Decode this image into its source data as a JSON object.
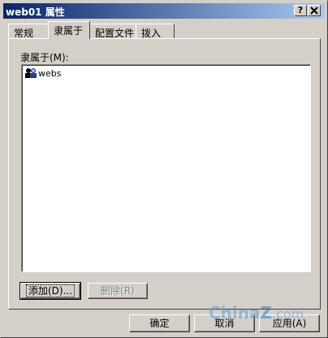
{
  "window": {
    "title": "web01 属性",
    "help_btn": "?",
    "close_btn": "X"
  },
  "tabs": [
    {
      "label": "常规"
    },
    {
      "label": "隶属于"
    },
    {
      "label": "配置文件"
    },
    {
      "label": "拨入"
    }
  ],
  "panel": {
    "member_of_label": "隶属于(M):",
    "list_items": [
      {
        "name": "webs",
        "icon": "group-icon"
      }
    ]
  },
  "buttons": {
    "add": "添加(D)...",
    "remove": "删除(R)",
    "ok": "确定",
    "cancel": "取消",
    "apply": "应用(A)"
  },
  "watermark": {
    "part1": "China",
    "part2": "Z",
    "part3": ".com"
  }
}
